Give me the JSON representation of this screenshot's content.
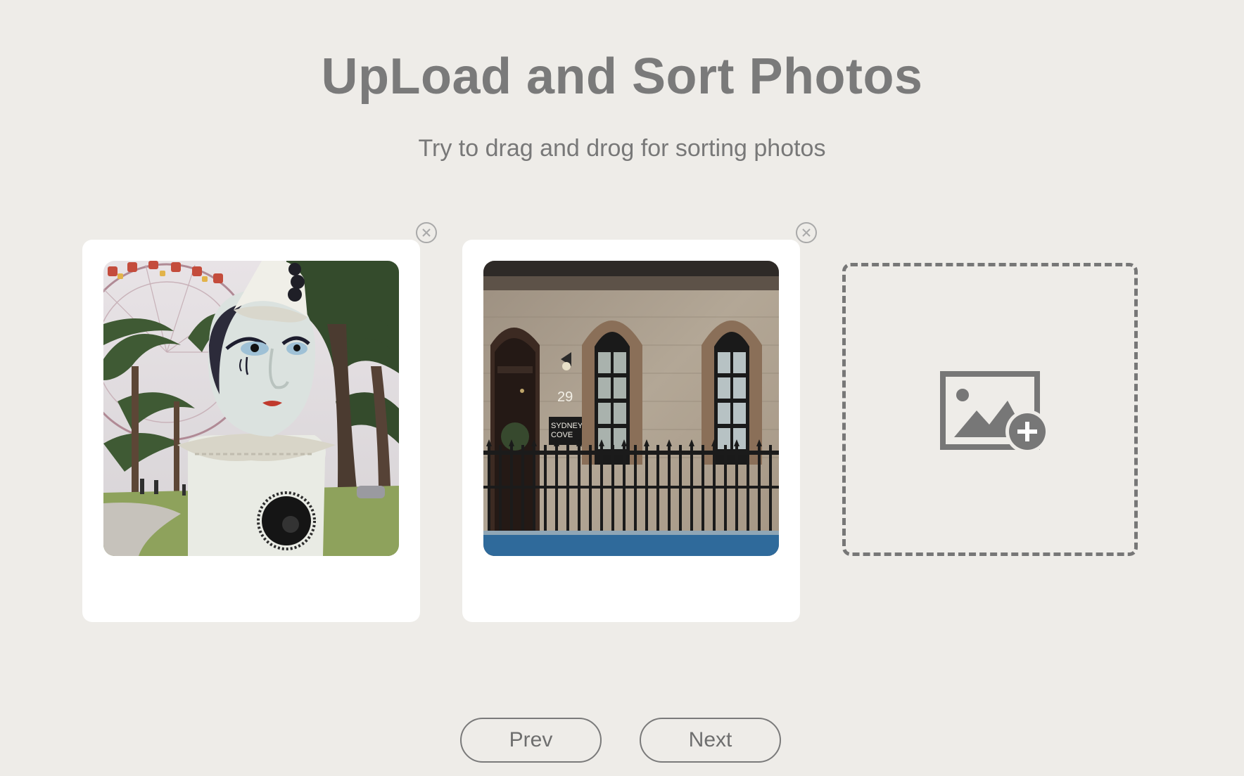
{
  "header": {
    "title": "UpLoad and Sort Photos",
    "subtitle": "Try to drag and drog for sorting photos"
  },
  "photos": [
    {
      "icon": "close-icon",
      "subject": "clown-statue-photo"
    },
    {
      "icon": "close-icon",
      "subject": "sandstone-building-photo",
      "sign_text": "SYDNEY COVE",
      "house_number": "29"
    }
  ],
  "add_slot": {
    "icon": "add-image-icon"
  },
  "nav": {
    "prev_label": "Prev",
    "next_label": "Next"
  },
  "colors": {
    "background": "#eeece8",
    "text": "#7a7a7a",
    "card": "#ffffff",
    "dashed_border": "#777777"
  }
}
